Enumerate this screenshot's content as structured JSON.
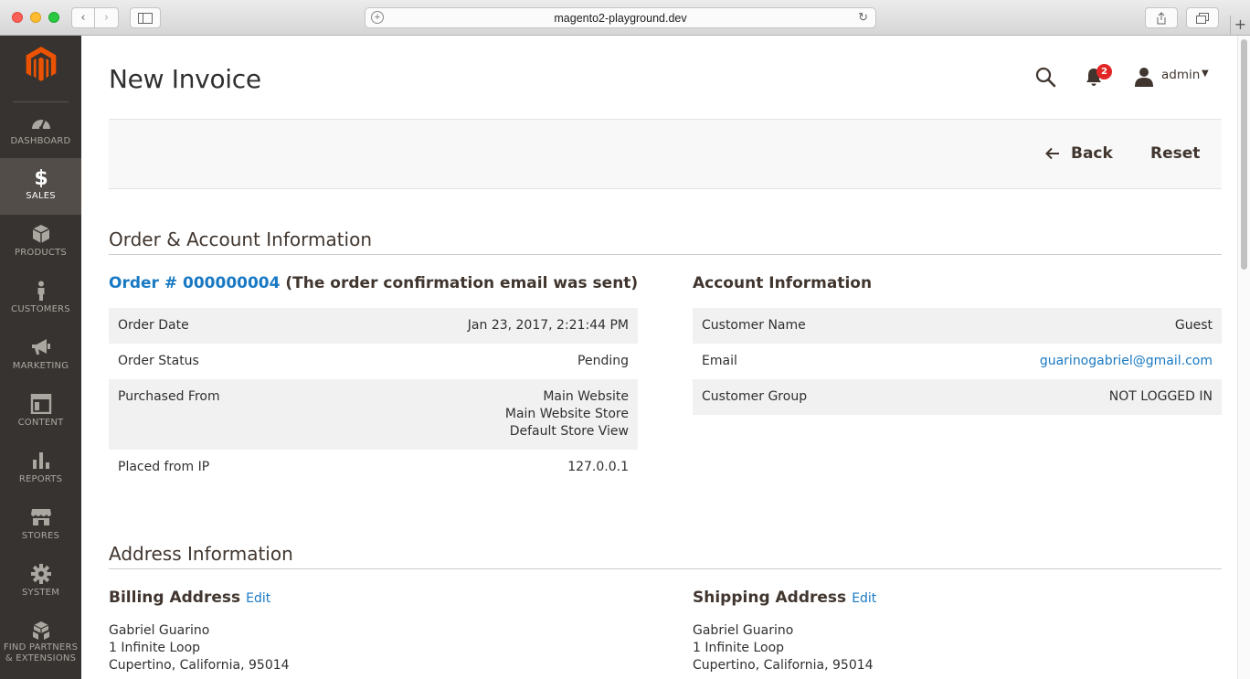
{
  "browser": {
    "url": "magento2-playground.dev"
  },
  "sidebar": {
    "items": [
      {
        "label": "DASHBOARD",
        "icon": "dashboard-icon"
      },
      {
        "label": "SALES",
        "icon": "dollar-icon",
        "active": true
      },
      {
        "label": "PRODUCTS",
        "icon": "box-icon"
      },
      {
        "label": "CUSTOMERS",
        "icon": "person-icon"
      },
      {
        "label": "MARKETING",
        "icon": "megaphone-icon"
      },
      {
        "label": "CONTENT",
        "icon": "layout-icon"
      },
      {
        "label": "REPORTS",
        "icon": "bar-chart-icon"
      },
      {
        "label": "STORES",
        "icon": "storefront-icon"
      },
      {
        "label": "SYSTEM",
        "icon": "gear-icon"
      },
      {
        "label_line1": "FIND PARTNERS",
        "label_line2": "& EXTENSIONS",
        "icon": "boxes-icon"
      }
    ]
  },
  "header": {
    "title": "New Invoice",
    "notifications_count": "2",
    "user": "admin"
  },
  "actions": {
    "back": "Back",
    "reset": "Reset"
  },
  "order_section": {
    "title": "Order & Account Information",
    "order_link": "Order # 000000004",
    "order_note": "(The order confirmation email was sent)",
    "rows": [
      {
        "label": "Order Date",
        "value": "Jan 23, 2017, 2:21:44 PM"
      },
      {
        "label": "Order Status",
        "value": "Pending"
      },
      {
        "label": "Purchased From",
        "value_lines": [
          "Main Website",
          "Main Website Store",
          "Default Store View"
        ]
      },
      {
        "label": "Placed from IP",
        "value": "127.0.0.1"
      }
    ]
  },
  "account_section": {
    "title": "Account Information",
    "rows": [
      {
        "label": "Customer Name",
        "value": "Guest"
      },
      {
        "label": "Email",
        "value": "guarinogabriel@gmail.com"
      },
      {
        "label": "Customer Group",
        "value": "NOT LOGGED IN"
      }
    ]
  },
  "address_section": {
    "title": "Address Information",
    "billing": {
      "title": "Billing Address",
      "edit": "Edit",
      "lines": [
        "Gabriel Guarino",
        "1 Infinite Loop",
        "Cupertino, California, 95014"
      ]
    },
    "shipping": {
      "title": "Shipping Address",
      "edit": "Edit",
      "lines": [
        "Gabriel Guarino",
        "1 Infinite Loop",
        "Cupertino, California, 95014"
      ]
    }
  },
  "colors": {
    "sidebar_bg": "#373330",
    "sidebar_active": "#524d49",
    "brand_orange": "#eb5202",
    "link_blue": "#1979c3",
    "badge_red": "#e22626"
  }
}
